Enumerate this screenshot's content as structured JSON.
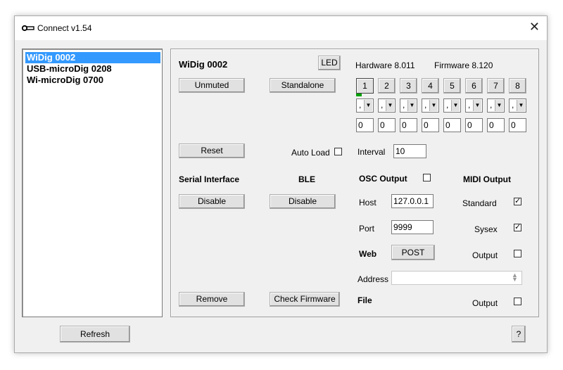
{
  "window": {
    "title": "Connect v1.54",
    "app_icon": "key-icon",
    "close_icon": "close-icon"
  },
  "devices": [
    {
      "label": "WiDig 0002",
      "selected": true
    },
    {
      "label": "USB-microDig 0208",
      "selected": false
    },
    {
      "label": "Wi-microDig 0700",
      "selected": false
    }
  ],
  "panel": {
    "device_name": "WiDig 0002",
    "led_label": "LED",
    "hardware": "Hardware 8.011",
    "firmware": "Firmware 8.120",
    "unmuted_label": "Unmuted",
    "standalone_label": "Standalone",
    "channels": [
      "1",
      "2",
      "3",
      "4",
      "5",
      "6",
      "7",
      "8"
    ],
    "channel_selects": [
      ",",
      ",",
      ",",
      ",",
      ",",
      ",",
      ",",
      ","
    ],
    "channel_values": [
      "0",
      "0",
      "0",
      "0",
      "0",
      "0",
      "0",
      "0"
    ],
    "reset_label": "Reset",
    "auto_load_label": "Auto Load",
    "interval_label": "Interval",
    "interval_value": "10",
    "serial_interface_label": "Serial Interface",
    "ble_label": "BLE",
    "osc_output_label": "OSC Output",
    "midi_output_label": "MIDI Output",
    "serial_disable_label": "Disable",
    "ble_disable_label": "Disable",
    "host_label": "Host",
    "host_value": "127.0.0.1",
    "standard_label": "Standard",
    "standard_checked": true,
    "port_label": "Port",
    "port_value": "9999",
    "sysex_label": "Sysex",
    "sysex_checked": true,
    "web_label": "Web",
    "post_label": "POST",
    "web_output_label": "Output",
    "address_label": "Address",
    "address_value": "",
    "remove_label": "Remove",
    "check_firmware_label": "Check Firmware",
    "file_label": "File",
    "file_output_label": "Output",
    "osc_checked": false,
    "auto_load_checked": false,
    "web_output_checked": false,
    "file_output_checked": false
  },
  "footer": {
    "refresh_label": "Refresh",
    "help_label": "?"
  },
  "colors": {
    "selection": "#3399ff",
    "window_bg": "#f0f0f0",
    "indicator": "#00a000"
  }
}
